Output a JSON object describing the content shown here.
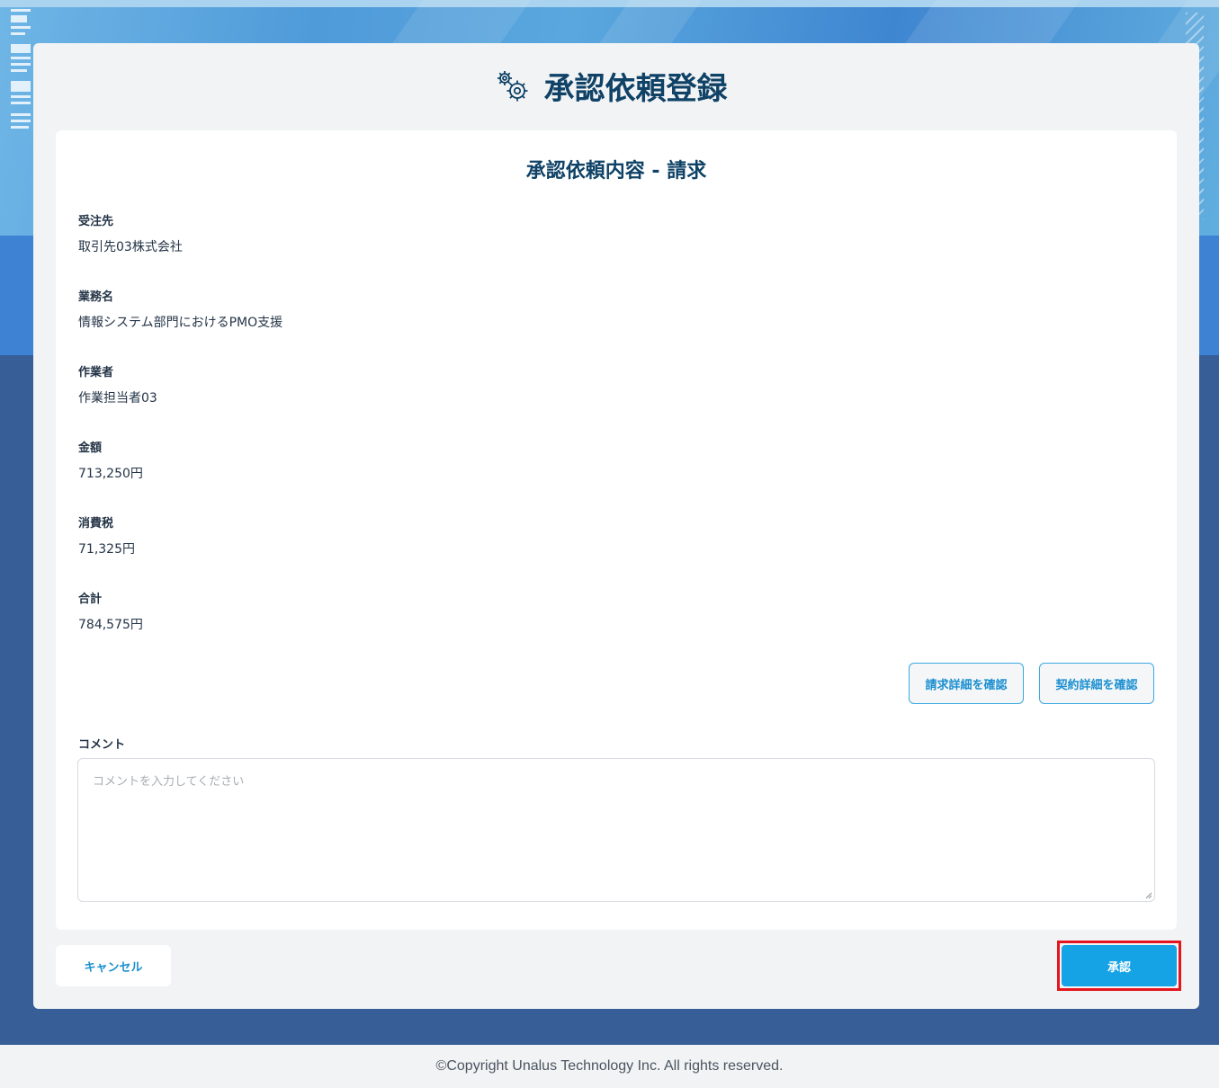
{
  "page": {
    "title": "承認依頼登録",
    "title_icon": "gear-icon"
  },
  "panel": {
    "title": "承認依頼内容 - 請求",
    "fields": [
      {
        "label": "受注先",
        "value": "取引先03株式会社"
      },
      {
        "label": "業務名",
        "value": "情報システム部門におけるPMO支援"
      },
      {
        "label": "作業者",
        "value": "作業担当者03"
      },
      {
        "label": "金額",
        "value": "713,250円"
      },
      {
        "label": "消費税",
        "value": "71,325円"
      },
      {
        "label": "合計",
        "value": "784,575円"
      }
    ],
    "buttons": {
      "invoice_detail": "請求詳細を確認",
      "contract_detail": "契約詳細を確認"
    },
    "comment": {
      "label": "コメント",
      "placeholder": "コメントを入力してください",
      "value": ""
    }
  },
  "actions": {
    "cancel": "キャンセル",
    "approve": "承認"
  },
  "footer": {
    "copyright": "©Copyright Unalus Technology Inc. All rights reserved."
  },
  "colors": {
    "title": "#0f4266",
    "accent": "#15a3e6",
    "highlight": "#e3151e",
    "background_dark": "#375e97"
  }
}
